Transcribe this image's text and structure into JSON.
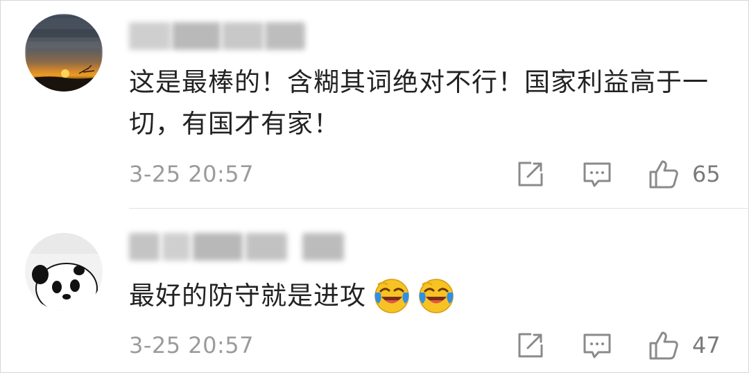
{
  "comments": [
    {
      "text": "这是最棒的！含糊其词绝对不行！国家利益高于一切，有国才有家！",
      "time": "3-25 20:57",
      "likes": "65",
      "avatar_icon": "sunset-avatar",
      "emojis": []
    },
    {
      "text": "最好的防守就是进攻",
      "time": "3-25 20:57",
      "likes": "47",
      "avatar_icon": "panda-avatar",
      "emojis": [
        "laughing-crying-emoji",
        "laughing-crying-emoji"
      ]
    }
  ],
  "colors": {
    "text": "#222222",
    "meta": "#9b9b9b",
    "icon": "#8a8a8a",
    "divider": "#e2e2e2",
    "emoji_face": "#f7c324",
    "emoji_tear": "#2e8fe6"
  }
}
